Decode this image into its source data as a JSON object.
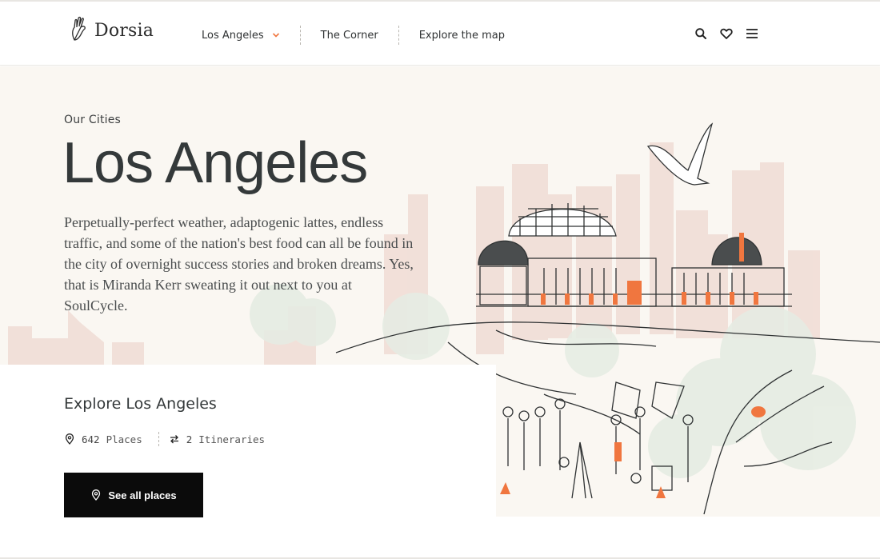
{
  "brand": {
    "name": "Dorsia"
  },
  "nav": {
    "city_label": "Los Angeles",
    "corner_label": "The Corner",
    "map_label": "Explore the map"
  },
  "icons": {
    "search": "search-icon",
    "favorites": "heart-icon",
    "menu": "hamburger-menu-icon",
    "dropdown": "chevron-down-icon",
    "pin": "map-pin-icon",
    "itinerary": "repeat-arrows-icon"
  },
  "colors": {
    "accent": "#f0763f",
    "button_bg": "#0b0b0b",
    "hero_bg": "#faf7f2",
    "skyline": "#f0dcd5",
    "foliage": "#e6ece3",
    "ink": "#34393a"
  },
  "hero": {
    "eyebrow": "Our Cities",
    "title": "Los Angeles",
    "intro": "Perpetually-perfect weather, adaptogenic lattes, endless traffic, and some of the nation's best food can all be found in the city of overnight success stories and broken dreams. Yes, that is Miranda Kerr sweating it out next to you at SoulCycle."
  },
  "explore": {
    "title": "Explore Los Angeles",
    "places_count": "642",
    "places_label": "Places",
    "itineraries_count": "2",
    "itineraries_label": "Itineraries",
    "button_label": "See all places"
  }
}
